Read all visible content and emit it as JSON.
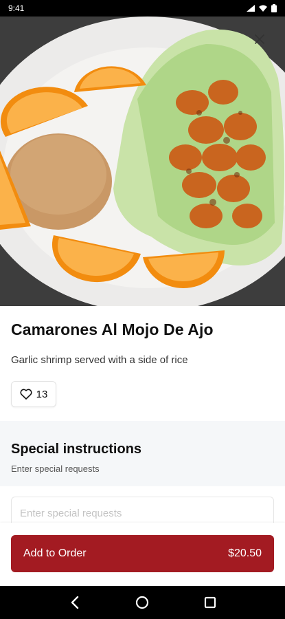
{
  "status_bar": {
    "time": "9:41",
    "icons": [
      "signal-icon",
      "wifi-icon",
      "battery-icon"
    ]
  },
  "hero": {
    "description_icon": "close-icon"
  },
  "item": {
    "title": "Camarones Al Mojo De Ajo",
    "description": "Garlic shrimp served with a side of rice",
    "likes": "13"
  },
  "instructions": {
    "title": "Special instructions",
    "subtitle": "Enter special requests",
    "placeholder": "Enter special requests"
  },
  "footer": {
    "add_label": "Add to Order",
    "price": "$20.50"
  },
  "colors": {
    "accent": "#a31b22",
    "section_bg": "#f5f7f9"
  },
  "nav": {
    "buttons": [
      "back-icon",
      "home-icon",
      "recents-icon"
    ]
  }
}
